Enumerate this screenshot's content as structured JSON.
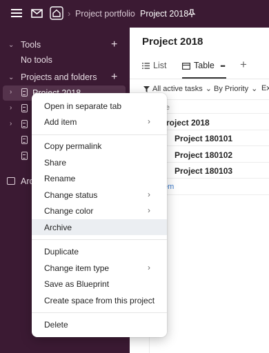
{
  "topbar": {
    "crumb_portfolio": "Project portfolio",
    "crumb_current": "Project 2018",
    "icons": [
      "menu-icon",
      "mail-icon",
      "home-icon",
      "pin-icon"
    ]
  },
  "sidebar": {
    "tools_label": "Tools",
    "no_tools": "No tools",
    "projects_label": "Projects and folders",
    "selected_item": "Project 2018",
    "archive_label": "Arc"
  },
  "main": {
    "title": "Project 2018",
    "tab_list": "List",
    "tab_table": "Table",
    "tab_more": "•••",
    "filter_tasks": "All active tasks",
    "filter_priority": "By Priority",
    "filter_extra": "Ex",
    "col_header": "me",
    "rows": [
      "roject 2018",
      "Project 180101",
      "Project 180102",
      "Project 180103"
    ],
    "new_item": "tem"
  },
  "context_menu": {
    "open_new_tab": "Open in separate tab",
    "add_item": "Add item",
    "copy_permalink": "Copy permalink",
    "share": "Share",
    "rename": "Rename",
    "change_status": "Change status",
    "change_color": "Change color",
    "archive": "Archive",
    "duplicate": "Duplicate",
    "change_item_type": "Change item type",
    "save_blueprint": "Save as Blueprint",
    "create_space": "Create space from this project",
    "delete": "Delete"
  }
}
